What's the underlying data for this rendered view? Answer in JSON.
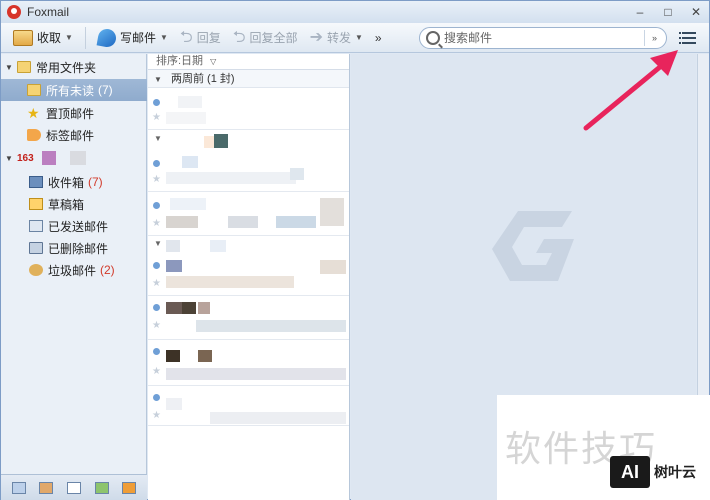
{
  "app": {
    "title": "Foxmail"
  },
  "window_controls": [
    "–",
    "□",
    "✕"
  ],
  "toolbar": {
    "receive": "收取",
    "write": "写邮件",
    "reply": "回复",
    "reply_all": "回复全部",
    "forward": "转发",
    "more": "»"
  },
  "search": {
    "placeholder": "搜索邮件",
    "dropdown": "»"
  },
  "sidebar": {
    "common_folder": "常用文件夹",
    "unread": {
      "label": "所有未读",
      "count": "(7)"
    },
    "pinned": "置顶邮件",
    "tagged": "标签邮件",
    "account": "163",
    "inbox": {
      "label": "收件箱",
      "count": "(7)"
    },
    "drafts": "草稿箱",
    "sent": "已发送邮件",
    "deleted": "已删除邮件",
    "junk": {
      "label": "垃圾邮件",
      "count": "(2)"
    }
  },
  "maillist": {
    "sort": "排序:日期",
    "group": "两周前 (1 封)"
  },
  "watermark": {
    "text": "软件技巧",
    "badge": "AI",
    "site": "树叶云"
  },
  "colors": {
    "accent_arrow": "#e8245c",
    "unread_dot": "#6f9fd6",
    "count_red": "#d23a2a"
  }
}
